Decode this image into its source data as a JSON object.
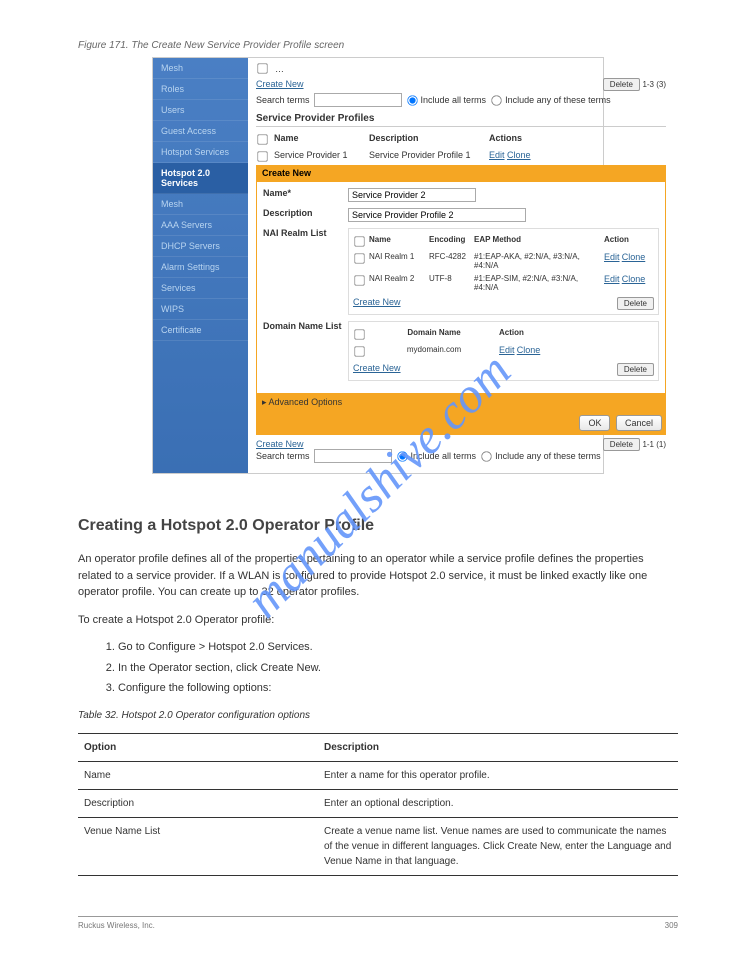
{
  "figure_caption_prefix": "Figure 171.",
  "figure_caption": "The Create New Service Provider Profile screen",
  "sidebar": {
    "items": [
      "Mesh",
      "Roles",
      "Users",
      "Guest Access",
      "Hotspot Services",
      "Hotspot 2.0 Services",
      "Mesh",
      "AAA Servers",
      "DHCP Servers",
      "Alarm Settings",
      "Services",
      "WIPS",
      "Certificate"
    ],
    "active_index": 5
  },
  "top": {
    "create_new": "Create New",
    "delete": "Delete",
    "pager": "1-3 (3)",
    "search_label": "Search terms",
    "include_all": "Include all terms",
    "include_any": "Include any of these terms"
  },
  "section_title": "Service Provider Profiles",
  "profiles_table": {
    "headers": {
      "name": "Name",
      "description": "Description",
      "actions": "Actions"
    },
    "rows": [
      {
        "name": "Service Provider 1",
        "description": "Service Provider Profile 1",
        "actions": [
          "Edit",
          "Clone"
        ]
      }
    ]
  },
  "create_new_band": "Create New",
  "form": {
    "name_label": "Name*",
    "name_value": "Service Provider 2",
    "description_label": "Description",
    "description_value": "Service Provider Profile 2",
    "nai_label": "NAI Realm List",
    "nai_table": {
      "headers": {
        "name": "Name",
        "encoding": "Encoding",
        "eap": "EAP Method",
        "action": "Action"
      },
      "rows": [
        {
          "name": "NAI Realm 1",
          "encoding": "RFC-4282",
          "eap": "#1:EAP-AKA, #2:N/A, #3:N/A, #4:N/A",
          "actions": [
            "Edit",
            "Clone"
          ]
        },
        {
          "name": "NAI Realm 2",
          "encoding": "UTF-8",
          "eap": "#1:EAP-SIM, #2:N/A, #3:N/A, #4:N/A",
          "actions": [
            "Edit",
            "Clone"
          ]
        }
      ],
      "create_new": "Create New",
      "delete": "Delete"
    },
    "domain_label": "Domain Name List",
    "domain_table": {
      "headers": {
        "name": "Domain Name",
        "action": "Action"
      },
      "rows": [
        {
          "name": "mydomain.com",
          "actions": [
            "Edit",
            "Clone"
          ]
        }
      ],
      "create_new": "Create New",
      "delete": "Delete"
    },
    "advanced": "Advanced Options",
    "ok": "OK",
    "cancel": "Cancel"
  },
  "bottom_bar": {
    "create_new": "Create New",
    "delete": "Delete",
    "pager": "1-1 (1)",
    "search_label": "Search terms",
    "include_all": "Include all terms",
    "include_any": "Include any of these terms"
  },
  "watermark": "manualshive.com",
  "doc": {
    "heading": "Creating a Hotspot 2.0 Operator Profile",
    "intro": "An operator profile defines all of the properties pertaining to an operator while a service profile defines the properties related to a service provider. If a WLAN is configured to provide Hotspot 2.0 service, it must be linked exactly like one operator profile. You can create up to 32 operator profiles.",
    "to_create": "To create a Hotspot 2.0 Operator profile:",
    "steps": [
      "Go to Configure > Hotspot 2.0 Services.",
      "In the Operator section, click Create New.",
      "Configure the following options:"
    ],
    "table_caption": "Table 32. Hotspot 2.0 Operator configuration options",
    "table": {
      "headers": [
        "Option",
        "Description"
      ],
      "rows": [
        [
          "Name",
          "Enter a name for this operator profile."
        ],
        [
          "Description",
          "Enter an optional description."
        ],
        [
          "Venue Name List",
          "Create a venue name list. Venue names are used to communicate the names of the venue in different languages. Click Create New, enter the Language and Venue Name in that language."
        ]
      ]
    }
  },
  "footer": {
    "left": "Ruckus Wireless, Inc.",
    "right": "309"
  }
}
